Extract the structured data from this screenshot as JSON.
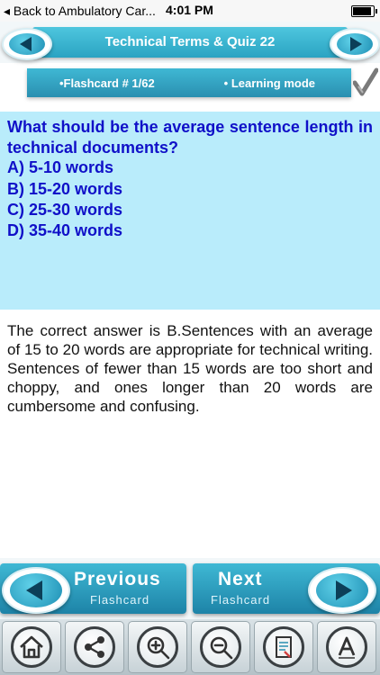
{
  "status_bar": {
    "back_label": "◂ Back to Ambulatory Car...",
    "time": "4:01 PM"
  },
  "header": {
    "title": "Technical Terms & Quiz  22"
  },
  "subbar": {
    "flashcard": "•Flashcard #  1/62",
    "mode": "• Learning mode"
  },
  "question": {
    "text": "What should be the average sentence length in technical documents?",
    "options": [
      "A) 5-10 words",
      "B) 15-20 words",
      "C) 25-30 words",
      "D) 35-40 words"
    ]
  },
  "answer": {
    "text": "The correct answer is B.Sentences with an average of 15 to 20 words are appropriate for technical writing. Sentences of fewer than 15 words are too short and choppy, and ones longer than 20 words are cumbersome and confusing."
  },
  "navigation": {
    "previous": {
      "title": "Previous",
      "subtitle": "Flashcard"
    },
    "next": {
      "title": "Next",
      "subtitle": "Flashcard"
    }
  },
  "toolbar": {
    "icons": [
      "home-icon",
      "share-icon",
      "zoom-in-icon",
      "zoom-out-icon",
      "document-icon",
      "font-icon"
    ]
  },
  "colors": {
    "accent": "#2aa3c2",
    "question_bg": "#b9ecfb",
    "question_text": "#1010c8"
  }
}
